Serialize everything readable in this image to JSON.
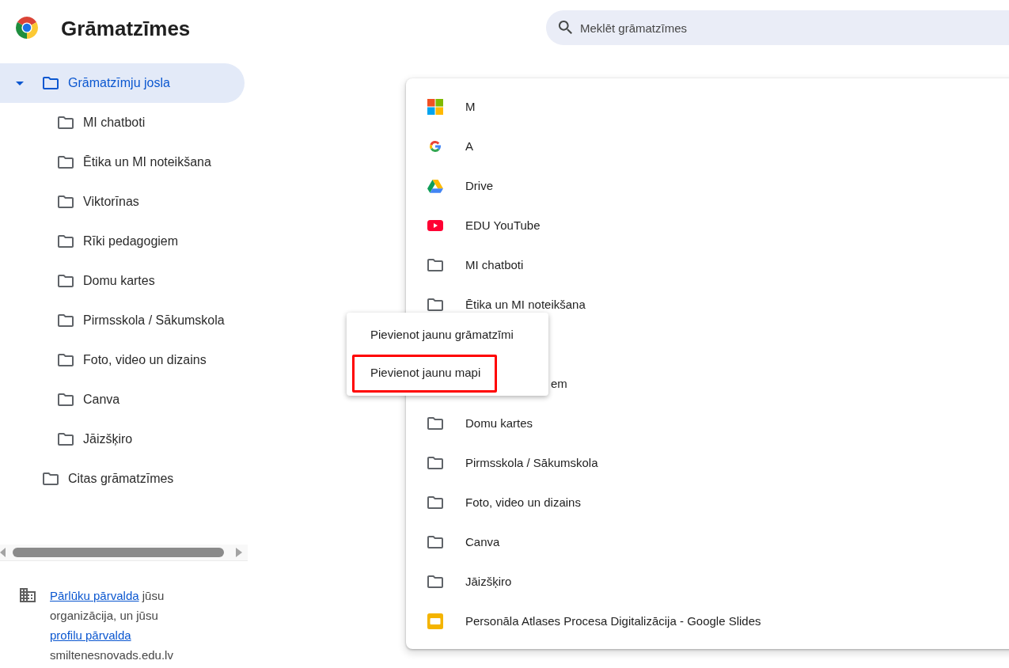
{
  "header": {
    "title": "Grāmatzīmes",
    "search": {
      "placeholder": "Meklēt grāmatzīmes"
    }
  },
  "tree": [
    {
      "label": "Grāmatzīmju josla",
      "selected": true,
      "expanded": true,
      "children": [
        {
          "label": "MI chatboti",
          "selected": false
        },
        {
          "label": "Ētika un MI noteikšana",
          "selected": false
        },
        {
          "label": "Viktorīnas",
          "selected": false
        },
        {
          "label": "Rīki pedagogiem",
          "selected": false
        },
        {
          "label": "Domu kartes",
          "selected": false
        },
        {
          "label": "Pirmsskola / Sākumskola",
          "selected": false
        },
        {
          "label": "Foto, video un dizains",
          "selected": false
        },
        {
          "label": "Canva",
          "selected": false
        },
        {
          "label": "Jāizšķiro",
          "selected": false
        }
      ]
    },
    {
      "label": "Citas grāmatzīmes",
      "selected": false
    }
  ],
  "managed_notice": {
    "parts": [
      {
        "kind": "link",
        "text": "Pārlūku pārvalda"
      },
      {
        "kind": "text",
        "text": "jūsu organizācija, un jūsu"
      },
      {
        "kind": "link",
        "text": "profilu pārvalda"
      }
    ],
    "domain": "smiltenesnovads.edu.lv"
  },
  "bookmarks": [
    {
      "kind": "squares",
      "title": "M"
    },
    {
      "kind": "google",
      "title": "A"
    },
    {
      "kind": "drive",
      "title": "Drive"
    },
    {
      "kind": "video",
      "title": "EDU YouTube"
    },
    {
      "kind": "folder",
      "title": "MI chatboti"
    },
    {
      "kind": "folder",
      "title": "Ētika un MI noteikšana"
    },
    {
      "kind": "covered"
    },
    {
      "kind": "covered",
      "title": "em"
    },
    {
      "kind": "folder",
      "title": "Domu kartes"
    },
    {
      "kind": "folder",
      "title": "Pirmsskola / Sākumskola"
    },
    {
      "kind": "folder",
      "title": "Foto, video un dizains"
    },
    {
      "kind": "folder",
      "title": "Canva"
    },
    {
      "kind": "folder",
      "title": "Jāizšķiro"
    },
    {
      "kind": "slides",
      "title": "Personāla Atlases Procesa Digitalizācija - Google Slides"
    }
  ],
  "context_menu": {
    "items": [
      {
        "label": "Pievienot jaunu grāmatzīmi",
        "highlighted": false
      },
      {
        "label": "Pievienot jaunu mapi",
        "highlighted": true
      }
    ]
  }
}
